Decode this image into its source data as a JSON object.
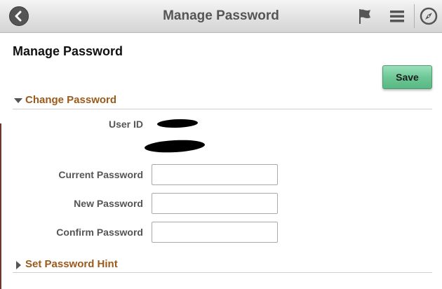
{
  "header": {
    "title": "Manage Password",
    "icons": [
      "back-arrow-icon",
      "flag-icon",
      "hamburger-menu-icon",
      "compass-icon"
    ]
  },
  "page": {
    "title": "Manage Password",
    "save_label": "Save"
  },
  "sections": {
    "change_password": {
      "label": "Change Password",
      "expanded": true
    },
    "password_hint": {
      "label": "Set Password Hint",
      "expanded": false
    }
  },
  "fields": {
    "user_id_label": "User ID",
    "current_password_label": "Current Password",
    "current_password_value": "",
    "new_password_label": "New Password",
    "new_password_value": "",
    "confirm_password_label": "Confirm Password",
    "confirm_password_value": ""
  },
  "colors": {
    "section_accent": "#9c5a1a",
    "save_button": "#6ec896",
    "header_text": "#555555"
  }
}
